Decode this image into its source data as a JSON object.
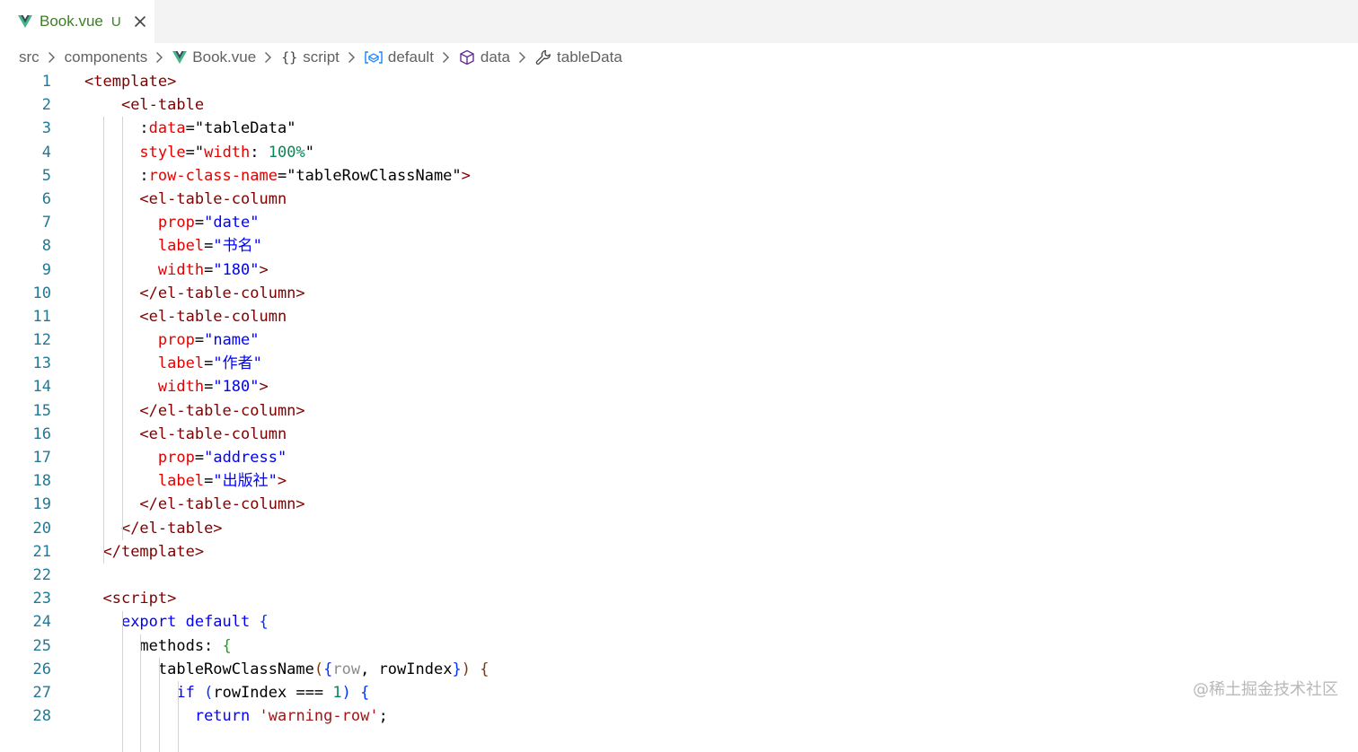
{
  "tab": {
    "title": "Book.vue",
    "status": "U",
    "icon": "vue-icon",
    "color": "#3f7d27"
  },
  "breadcrumb": [
    {
      "label": "src",
      "icon": ""
    },
    {
      "label": "components",
      "icon": ""
    },
    {
      "label": "Book.vue",
      "icon": "vue-icon"
    },
    {
      "label": "script",
      "icon": "braces-icon"
    },
    {
      "label": "default",
      "icon": "module-icon"
    },
    {
      "label": "data",
      "icon": "cube-icon"
    },
    {
      "label": "tableData",
      "icon": "wrench-icon"
    }
  ],
  "editor": {
    "line_numbers": [
      "1",
      "2",
      "3",
      "4",
      "5",
      "6",
      "7",
      "8",
      "9",
      "10",
      "11",
      "12",
      "13",
      "14",
      "15",
      "16",
      "17",
      "18",
      "19",
      "20",
      "21",
      "22",
      "23",
      "24",
      "25",
      "26",
      "27",
      "28"
    ],
    "lines": [
      [
        {
          "t": "<template>",
          "c": "t-tag"
        }
      ],
      [
        {
          "t": "    ",
          "c": "t-plain"
        },
        {
          "t": "<el-table",
          "c": "t-tag"
        }
      ],
      [
        {
          "t": "      :",
          "c": "t-plain"
        },
        {
          "t": "data",
          "c": "t-attr"
        },
        {
          "t": "=\"tableData\"",
          "c": "t-plain"
        }
      ],
      [
        {
          "t": "      ",
          "c": "t-plain"
        },
        {
          "t": "style",
          "c": "t-attr"
        },
        {
          "t": "=\"",
          "c": "t-plain"
        },
        {
          "t": "width",
          "c": "t-attr"
        },
        {
          "t": ": ",
          "c": "t-plain"
        },
        {
          "t": "100%",
          "c": "t-num"
        },
        {
          "t": "\"",
          "c": "t-plain"
        }
      ],
      [
        {
          "t": "      :",
          "c": "t-plain"
        },
        {
          "t": "row-class-name",
          "c": "t-attr"
        },
        {
          "t": "=\"tableRowClassName\"",
          "c": "t-plain"
        },
        {
          "t": ">",
          "c": "t-tag"
        }
      ],
      [
        {
          "t": "      ",
          "c": "t-plain"
        },
        {
          "t": "<el-table-column",
          "c": "t-tag"
        }
      ],
      [
        {
          "t": "        ",
          "c": "t-plain"
        },
        {
          "t": "prop",
          "c": "t-attr"
        },
        {
          "t": "=",
          "c": "t-plain"
        },
        {
          "t": "\"date\"",
          "c": "t-str"
        }
      ],
      [
        {
          "t": "        ",
          "c": "t-plain"
        },
        {
          "t": "label",
          "c": "t-attr"
        },
        {
          "t": "=",
          "c": "t-plain"
        },
        {
          "t": "\"书名\"",
          "c": "t-str"
        }
      ],
      [
        {
          "t": "        ",
          "c": "t-plain"
        },
        {
          "t": "width",
          "c": "t-attr"
        },
        {
          "t": "=",
          "c": "t-plain"
        },
        {
          "t": "\"180\"",
          "c": "t-str"
        },
        {
          "t": ">",
          "c": "t-tag"
        }
      ],
      [
        {
          "t": "      ",
          "c": "t-plain"
        },
        {
          "t": "</el-table-column>",
          "c": "t-tag"
        }
      ],
      [
        {
          "t": "      ",
          "c": "t-plain"
        },
        {
          "t": "<el-table-column",
          "c": "t-tag"
        }
      ],
      [
        {
          "t": "        ",
          "c": "t-plain"
        },
        {
          "t": "prop",
          "c": "t-attr"
        },
        {
          "t": "=",
          "c": "t-plain"
        },
        {
          "t": "\"name\"",
          "c": "t-str"
        }
      ],
      [
        {
          "t": "        ",
          "c": "t-plain"
        },
        {
          "t": "label",
          "c": "t-attr"
        },
        {
          "t": "=",
          "c": "t-plain"
        },
        {
          "t": "\"作者\"",
          "c": "t-str"
        }
      ],
      [
        {
          "t": "        ",
          "c": "t-plain"
        },
        {
          "t": "width",
          "c": "t-attr"
        },
        {
          "t": "=",
          "c": "t-plain"
        },
        {
          "t": "\"180\"",
          "c": "t-str"
        },
        {
          "t": ">",
          "c": "t-tag"
        }
      ],
      [
        {
          "t": "      ",
          "c": "t-plain"
        },
        {
          "t": "</el-table-column>",
          "c": "t-tag"
        }
      ],
      [
        {
          "t": "      ",
          "c": "t-plain"
        },
        {
          "t": "<el-table-column",
          "c": "t-tag"
        }
      ],
      [
        {
          "t": "        ",
          "c": "t-plain"
        },
        {
          "t": "prop",
          "c": "t-attr"
        },
        {
          "t": "=",
          "c": "t-plain"
        },
        {
          "t": "\"address\"",
          "c": "t-str"
        }
      ],
      [
        {
          "t": "        ",
          "c": "t-plain"
        },
        {
          "t": "label",
          "c": "t-attr"
        },
        {
          "t": "=",
          "c": "t-plain"
        },
        {
          "t": "\"出版社\"",
          "c": "t-str"
        },
        {
          "t": ">",
          "c": "t-tag"
        }
      ],
      [
        {
          "t": "      ",
          "c": "t-plain"
        },
        {
          "t": "</el-table-column>",
          "c": "t-tag"
        }
      ],
      [
        {
          "t": "    ",
          "c": "t-plain"
        },
        {
          "t": "</el-table>",
          "c": "t-tag"
        }
      ],
      [
        {
          "t": "  ",
          "c": "t-plain"
        },
        {
          "t": "</template>",
          "c": "t-tag"
        }
      ],
      [
        {
          "t": "",
          "c": "t-plain"
        }
      ],
      [
        {
          "t": "  ",
          "c": "t-plain"
        },
        {
          "t": "<script>",
          "c": "t-tag"
        }
      ],
      [
        {
          "t": "    ",
          "c": "t-plain"
        },
        {
          "t": "export default",
          "c": "t-kw"
        },
        {
          "t": " ",
          "c": "t-plain"
        },
        {
          "t": "{",
          "c": "t-b1"
        }
      ],
      [
        {
          "t": "      methods: ",
          "c": "t-plain"
        },
        {
          "t": "{",
          "c": "t-b2"
        }
      ],
      [
        {
          "t": "        tableRowClassName",
          "c": "t-plain"
        },
        {
          "t": "(",
          "c": "t-b3"
        },
        {
          "t": "{",
          "c": "t-b1"
        },
        {
          "t": "row",
          "c": "t-param"
        },
        {
          "t": ", rowIndex",
          "c": "t-plain"
        },
        {
          "t": "}",
          "c": "t-b1"
        },
        {
          "t": ")",
          "c": "t-b3"
        },
        {
          "t": " ",
          "c": "t-plain"
        },
        {
          "t": "{",
          "c": "t-b3"
        }
      ],
      [
        {
          "t": "          ",
          "c": "t-plain"
        },
        {
          "t": "if",
          "c": "t-kw"
        },
        {
          "t": " ",
          "c": "t-plain"
        },
        {
          "t": "(",
          "c": "t-b1"
        },
        {
          "t": "rowIndex === ",
          "c": "t-plain"
        },
        {
          "t": "1",
          "c": "t-num"
        },
        {
          "t": ")",
          "c": "t-b1"
        },
        {
          "t": " ",
          "c": "t-plain"
        },
        {
          "t": "{",
          "c": "t-b1"
        }
      ],
      [
        {
          "t": "            ",
          "c": "t-plain"
        },
        {
          "t": "return",
          "c": "t-kw"
        },
        {
          "t": " ",
          "c": "t-plain"
        },
        {
          "t": "'warning-row'",
          "c": "t-str2"
        },
        {
          "t": ";",
          "c": "t-plain"
        }
      ]
    ]
  },
  "watermark": "@稀土掘金技术社区"
}
